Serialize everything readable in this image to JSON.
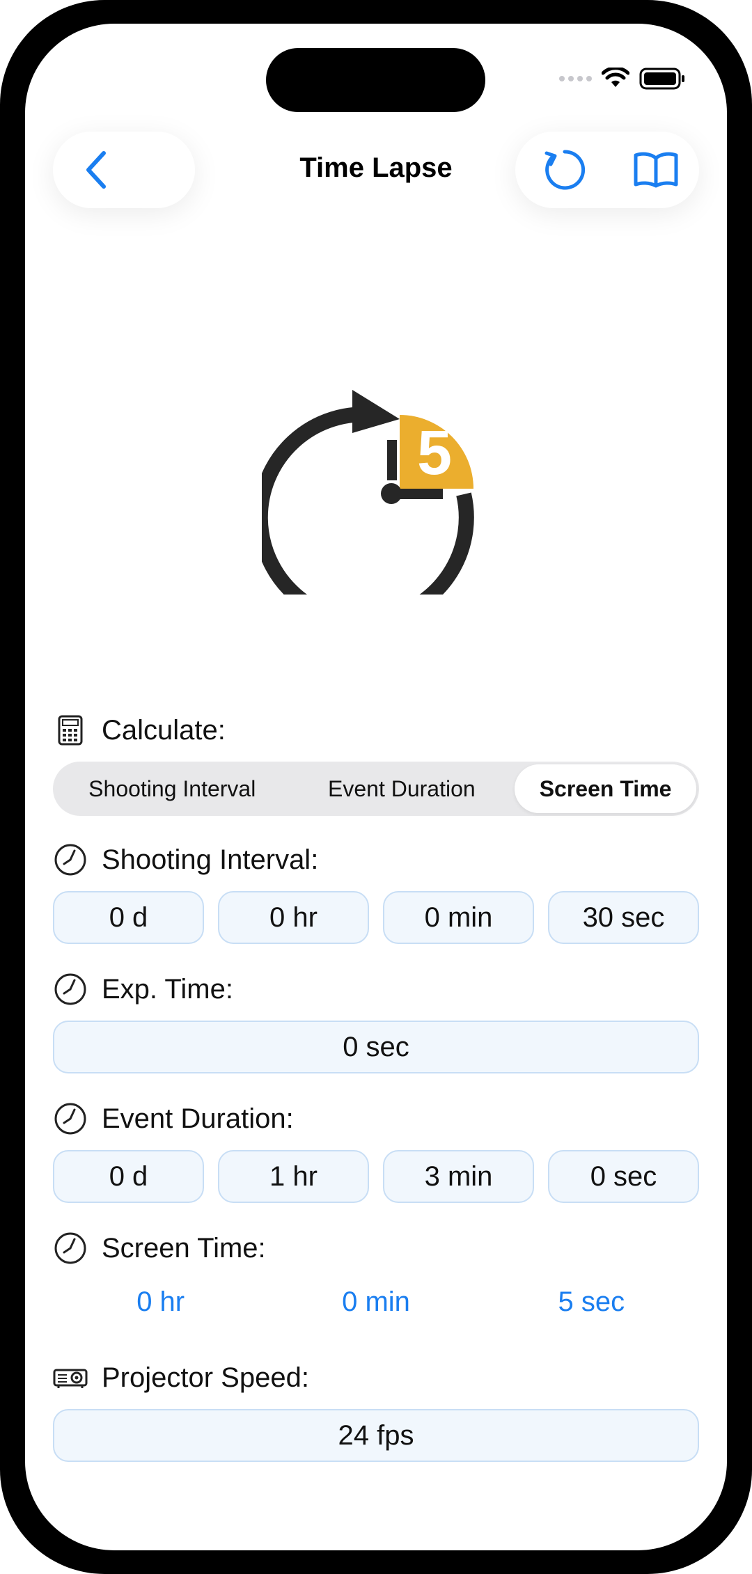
{
  "nav": {
    "title": "Time Lapse",
    "back_icon": "chevron-left-icon",
    "reset_icon": "reset-arrow-icon",
    "book_icon": "book-icon"
  },
  "hero": {
    "icon": "timer-5-icon",
    "badge_number": "5",
    "accent_color": "#EBAE2E"
  },
  "calculate": {
    "label": "Calculate:",
    "options": [
      "Shooting Interval",
      "Event Duration",
      "Screen Time"
    ],
    "selected": "Screen Time"
  },
  "shooting_interval": {
    "label": "Shooting Interval:",
    "values": [
      "0 d",
      "0 hr",
      "0 min",
      "30 sec"
    ]
  },
  "exp_time": {
    "label": "Exp. Time:",
    "value": "0 sec"
  },
  "event_duration": {
    "label": "Event Duration:",
    "values": [
      "0 d",
      "1 hr",
      "3 min",
      "0 sec"
    ]
  },
  "screen_time": {
    "label": "Screen Time:",
    "values": [
      "0 hr",
      "0 min",
      "5 sec"
    ]
  },
  "projector_speed": {
    "label": "Projector Speed:",
    "value": "24 fps"
  },
  "colors": {
    "accent": "#1A7EF0",
    "field_border": "#C8DEF5",
    "field_bg": "#F1F7FD"
  }
}
